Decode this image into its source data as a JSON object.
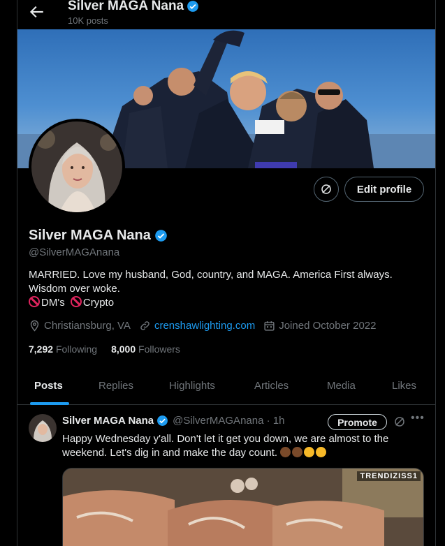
{
  "header": {
    "name": "Silver MAGA Nana",
    "post_count": "10K posts",
    "back_icon": "arrow-left-icon"
  },
  "profile": {
    "name": "Silver MAGA Nana",
    "handle": "@SilverMAGAnana",
    "bio_line1": "MARRIED.  Love my husband, God, country, and MAGA. America First always.",
    "bio_line2": "Wisdom over woke.",
    "bio_line3a": "DM's",
    "bio_line3b": "Crypto",
    "location": "Christiansburg, VA",
    "website": "crenshawlighting.com",
    "joined": "Joined October 2022",
    "following_count": "7,292",
    "following_label": "Following",
    "followers_count": "8,000",
    "followers_label": "Followers",
    "edit_button": "Edit profile",
    "verified_color": "#1d9bf0"
  },
  "tabs": [
    {
      "label": "Posts",
      "active": true
    },
    {
      "label": "Replies"
    },
    {
      "label": "Highlights"
    },
    {
      "label": "Articles"
    },
    {
      "label": "Media"
    },
    {
      "label": "Likes"
    }
  ],
  "post": {
    "name": "Silver MAGA Nana",
    "handle_time": "@SilverMAGAnana · 1h",
    "promote": "Promote",
    "more": "•••",
    "text_line1": "Happy Wednesday y'all.  Don't let it get you down, we are almost to the",
    "text_line2": "weekend.  Let's dig in and make the day count.",
    "media_tag": "TRENDIZISS1"
  },
  "colors": {
    "background": "#000000",
    "text": "#e7e9ea",
    "muted": "#71767b",
    "accent": "#1d9bf0"
  }
}
